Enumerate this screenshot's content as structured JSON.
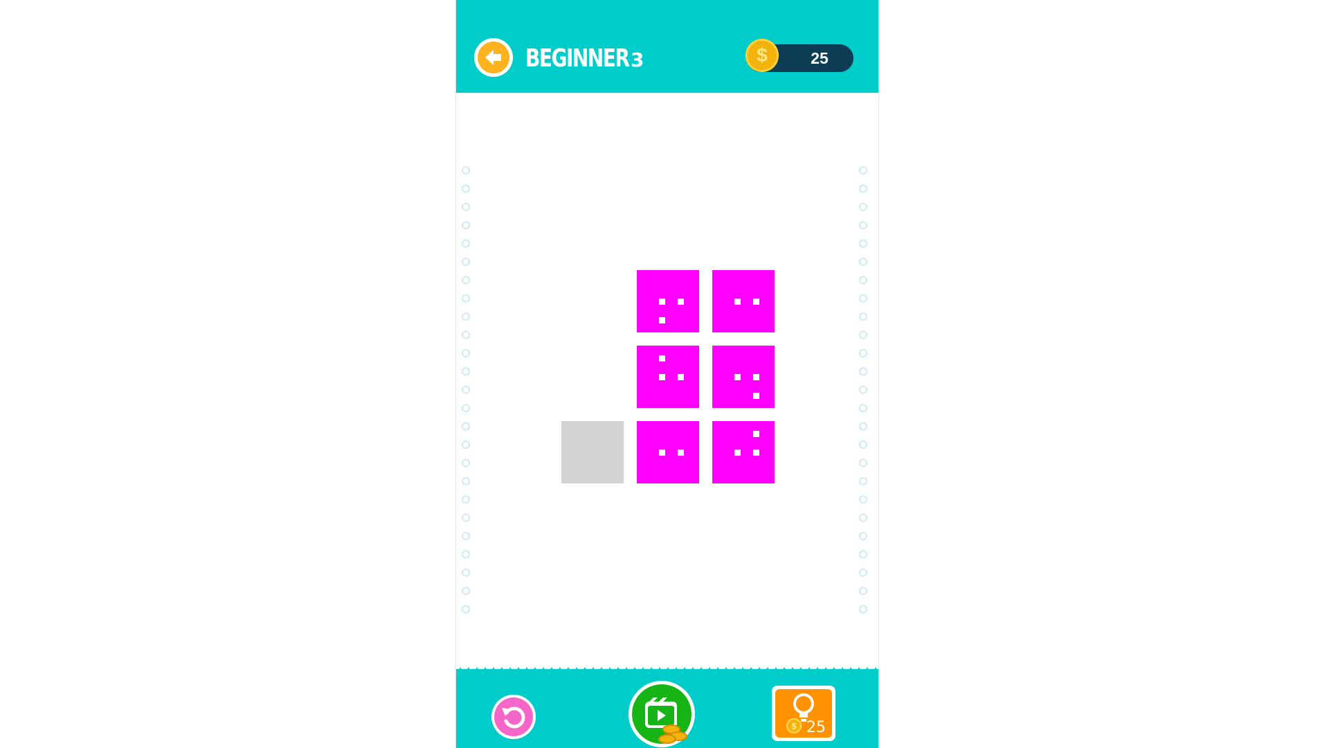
{
  "header": {
    "level_name": "BEGINNER",
    "level_number": "3",
    "coins": "25"
  },
  "board": {
    "rows": 3,
    "cols": 3,
    "tiles": [
      {
        "row": 0,
        "col": 1,
        "color": "#ff00ff",
        "pips": [
          [
            0,
            0
          ],
          [
            1,
            0
          ],
          [
            0,
            1
          ]
        ]
      },
      {
        "row": 0,
        "col": 2,
        "color": "#ff00ff",
        "pips": [
          [
            0,
            0
          ],
          [
            1,
            0
          ]
        ]
      },
      {
        "row": 1,
        "col": 1,
        "color": "#ff00ff",
        "pips": [
          [
            0,
            -1
          ],
          [
            0,
            0
          ],
          [
            1,
            0
          ]
        ]
      },
      {
        "row": 1,
        "col": 2,
        "color": "#ff00ff",
        "pips": [
          [
            0,
            0
          ],
          [
            1,
            0
          ],
          [
            1,
            1
          ]
        ]
      },
      {
        "row": 2,
        "col": 0,
        "color": "#d3d3d3",
        "pips": []
      },
      {
        "row": 2,
        "col": 1,
        "color": "#ff00ff",
        "pips": [
          [
            0,
            0
          ],
          [
            1,
            0
          ]
        ]
      },
      {
        "row": 2,
        "col": 2,
        "color": "#ff00ff",
        "pips": [
          [
            1,
            -1
          ],
          [
            0,
            0
          ],
          [
            1,
            0
          ]
        ]
      }
    ]
  },
  "footer": {
    "hint_cost": "25"
  },
  "icons": {
    "back": "back-arrow-icon",
    "coin": "dollar-coin-icon",
    "restart": "restart-icon",
    "video": "video-reward-icon",
    "hint": "lightbulb-icon"
  },
  "colors": {
    "bar": "#00cdc9",
    "tile": "#ff00ff",
    "empty_tile": "#d3d3d3",
    "coin_pill": "#0d3d55",
    "back_button": "#ffb21f",
    "restart_button": "#f566c9",
    "video_button": "#16b515",
    "hint_button": "#ff9200"
  }
}
